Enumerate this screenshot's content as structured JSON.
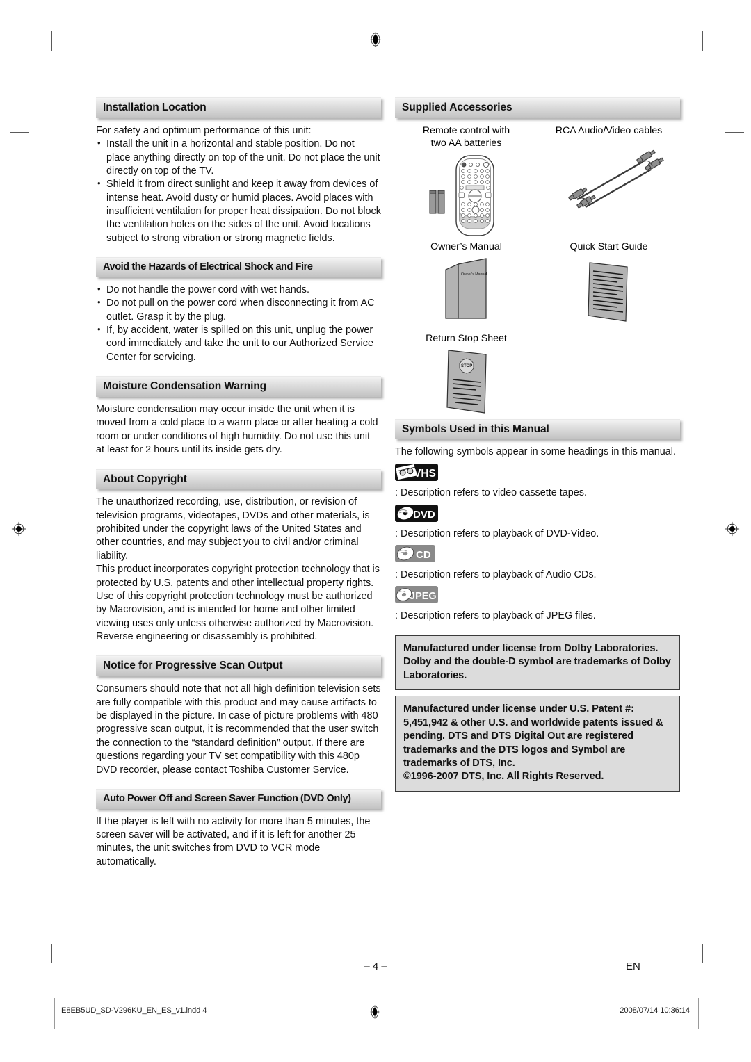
{
  "page": {
    "number_label": "– 4 –",
    "language_code": "EN",
    "footer_file": "E8EB5UD_SD-V296KU_EN_ES_v1.indd   4",
    "footer_date": "2008/07/14   10:36:14"
  },
  "left_column": {
    "sections": [
      {
        "heading": "Installation Location",
        "intro": "For safety and optimum performance of this unit:",
        "bullets": [
          "Install the unit in a horizontal and stable position. Do not place anything directly on top of the unit. Do not place the unit directly on top of the TV.",
          "Shield it from direct sunlight and keep it away from devices of intense heat. Avoid dusty or humid places. Avoid places with insufficient ventilation for proper heat dissipation. Do not block the ventilation holes on the sides of the unit. Avoid locations subject to strong vibration or strong magnetic fields."
        ]
      },
      {
        "heading": "Avoid the Hazards of Electrical Shock and Fire",
        "intro": "",
        "bullets": [
          "Do not handle the power cord with wet hands.",
          "Do not pull on the power cord when disconnecting it from AC outlet. Grasp it by the plug.",
          "If, by accident, water is spilled on this unit, unplug the power cord immediately and take the unit to our Authorized Service Center for servicing."
        ]
      },
      {
        "heading": "Moisture Condensation Warning",
        "paragraphs": [
          "Moisture condensation may occur inside the unit when it is moved from a cold place to a warm place or after heating a cold room or under conditions of high humidity. Do not use this unit at least for 2 hours until its inside gets dry."
        ]
      },
      {
        "heading": "About Copyright",
        "paragraphs": [
          "The unauthorized recording, use, distribution, or revision of television programs, videotapes, DVDs and other materials, is prohibited under the copyright laws of the United States and other countries, and may subject you to civil and/or criminal liability.",
          "This product incorporates copyright protection technology that is protected by U.S. patents and other intellectual property rights. Use of this copyright protection technology must be authorized by Macrovision, and is intended for home and other limited viewing uses only unless otherwise authorized by Macrovision. Reverse engineering or disassembly is prohibited."
        ]
      },
      {
        "heading": "Notice for Progressive Scan Output",
        "paragraphs": [
          "Consumers should note that not all high definition television sets are fully compatible with this product and may cause artifacts to be displayed in the picture. In case of picture problems with 480 progressive scan output, it is recommended that the user switch the connection to the “standard definition” output. If there are questions regarding your TV set compatibility with this 480p DVD recorder, please contact Toshiba Customer Service."
        ]
      },
      {
        "heading": "Auto Power Off and Screen Saver Function (DVD Only)",
        "paragraphs": [
          "If the player is left with no activity for more than 5 minutes, the screen saver will be activated, and if it is left for another 25 minutes, the unit switches from DVD to VCR mode automatically."
        ]
      }
    ]
  },
  "right_column": {
    "accessories": {
      "heading": "Supplied Accessories",
      "items": [
        {
          "label": "Remote control with\ntwo AA batteries",
          "art": "remote-control"
        },
        {
          "label": "RCA Audio/Video cables",
          "art": "rca-cables"
        },
        {
          "label": "Owner’s Manual",
          "art": "owners-manual-booklet",
          "cover_text": "Owner's Manual"
        },
        {
          "label": "Quick Start Guide",
          "art": "quick-start-sheet"
        },
        {
          "label": "Return Stop Sheet",
          "art": "return-stop-sheet",
          "stamp_text": "STOP"
        }
      ]
    },
    "symbols": {
      "heading": "Symbols Used in this Manual",
      "intro": "The following symbols appear in some headings in this manual.",
      "rows": [
        {
          "badge": "VHS",
          "badge_style": "dark",
          "icon": "cassette-tape-icon",
          "description": ": Description refers to video cassette tapes."
        },
        {
          "badge": "DVD",
          "badge_style": "dark",
          "icon": "disc-icon",
          "description": ": Description refers to playback of DVD-Video."
        },
        {
          "badge": "CD",
          "badge_style": "gray",
          "icon": "disc-icon",
          "description": ": Description refers to playback of Audio CDs."
        },
        {
          "badge": "JPEG",
          "badge_style": "gray",
          "icon": "disc-icon",
          "description": ": Description refers to playback of JPEG files."
        }
      ]
    },
    "license_boxes": [
      "Manufactured under license from Dolby Laboratories. Dolby and the double-D symbol are trademarks of Dolby Laboratories.",
      "Manufactured under license under U.S. Patent #: 5,451,942 & other U.S. and worldwide patents issued & pending. DTS and DTS Digital Out are registered trademarks and the DTS logos and Symbol are trademarks of DTS, Inc.\n©1996-2007 DTS, Inc. All Rights Reserved."
    ]
  },
  "colors": {
    "heading_bar_light": "#f4f4f4",
    "heading_bar_dark": "#c2c2c2",
    "license_box_fill": "#dcdcdc",
    "badge_dark": "#111111",
    "badge_gray": "#8a8a8a",
    "art_fill": "#b3b3b3"
  }
}
